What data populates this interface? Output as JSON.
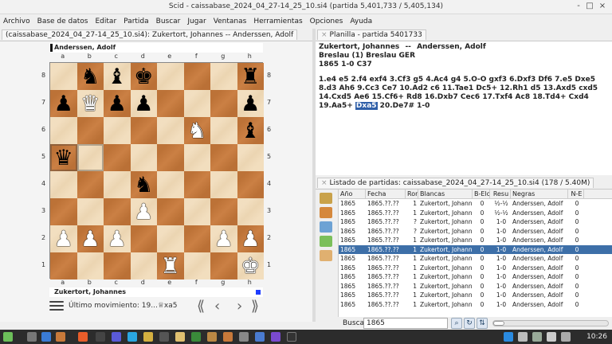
{
  "window": {
    "title": "Scid - caissabase_2024_04_27-14_25_10.si4 (partida 5,401,733 / 5,405,134)",
    "controls": [
      "-",
      "□",
      "×"
    ]
  },
  "menu": [
    "Archivo",
    "Base de datos",
    "Editar",
    "Partida",
    "Buscar",
    "Jugar",
    "Ventanas",
    "Herramientas",
    "Opciones",
    "Ayuda"
  ],
  "board_tab": "(caissabase_2024_04_27-14_25_10.si4): Zukertort, Johannes -- Anderssen, Adolf",
  "board": {
    "top_player": "Anderssen, Adolf",
    "bottom_player": "Zukertort, Johannes",
    "files": [
      "a",
      "b",
      "c",
      "d",
      "e",
      "f",
      "g",
      "h"
    ],
    "ranks": [
      "8",
      "7",
      "6",
      "5",
      "4",
      "3",
      "2",
      "1"
    ],
    "squares": [
      [
        "",
        "bN",
        "bB",
        "bK",
        "",
        "",
        "",
        "bR"
      ],
      [
        "bP",
        "wQ",
        "bP",
        "bP",
        "",
        "",
        "",
        "bP"
      ],
      [
        "",
        "",
        "",
        "",
        "",
        "wN",
        "",
        "bB"
      ],
      [
        "bQ",
        "",
        "",
        "",
        "",
        "",
        "",
        ""
      ],
      [
        "",
        "",
        "",
        "bN",
        "",
        "",
        "",
        ""
      ],
      [
        "",
        "",
        "",
        "wP",
        "",
        "",
        "",
        ""
      ],
      [
        "wP",
        "wP",
        "wP",
        "",
        "",
        "",
        "wP",
        "wP"
      ],
      [
        "",
        "",
        "",
        "",
        "wR",
        "",
        "",
        "wK"
      ]
    ],
    "highlight": [
      "a5",
      "b5"
    ],
    "last_move_label": "Último movimiento: 19...♕xa5",
    "nav_buttons": [
      "⟪",
      "‹",
      "›",
      "⟫"
    ]
  },
  "game_tab": "Planilla - partida 5401733",
  "game": {
    "white": "Zukertort, Johannes",
    "separator": "--",
    "black": "Anderssen, Adolf",
    "event": "Breslau (1)  Breslau GER",
    "year_result_eco": "1865  1-0  C37",
    "moves_before": "1.e4 e5 2.f4 exf4 3.Cf3 g5 4.Ac4 g4 5.O-O gxf3 6.Dxf3 Df6 7.e5 Dxe5 8.d3 Ah6 9.Cc3 Ce7 10.Ad2 c6 11.Tae1 Dc5+ 12.Rh1 d5 13.Axd5 cxd5 14.Cxd5 Ae6 15.Cf6+ Rd8 16.Dxb7 Cec6 17.Txf4 Ac8 18.Td4+ Cxd4 19.Aa5+ ",
    "current_move": "Dxa5",
    "moves_after": " 20.De7# 1-0"
  },
  "list_tab": "Listado de partidas: caissabase_2024_04_27-14_25_10.si4 (178 / 5.40M)",
  "list": {
    "columns": [
      "Año",
      "Fecha",
      "Ron",
      "Blancas",
      "B-Elo",
      "Resu",
      "Negras",
      "N-E"
    ],
    "rows": [
      [
        "1865",
        "1865.??.??",
        "1",
        "Zukertort, Johanne",
        "0",
        "½-½",
        "Anderssen, Adolf",
        "0"
      ],
      [
        "1865",
        "1865.??.??",
        "1",
        "Zukertort, Johanne",
        "0",
        "½-½",
        "Anderssen, Adolf",
        "0"
      ],
      [
        "1865",
        "1865.??.??",
        "?",
        "Zukertort, Johanne",
        "0",
        "1-0",
        "Anderssen, Adolf",
        "0"
      ],
      [
        "1865",
        "1865.??.??",
        "?",
        "Zukertort, Johanne",
        "0",
        "1-0",
        "Anderssen, Adolf",
        "0"
      ],
      [
        "1865",
        "1865.??.??",
        "1",
        "Zukertort, Johanne",
        "0",
        "1-0",
        "Anderssen, Adolf",
        "0"
      ],
      [
        "1865",
        "1865.??.??",
        "1",
        "Zukertort, Johanne",
        "0",
        "1-0",
        "Anderssen, Adolf",
        "0"
      ],
      [
        "1865",
        "1865.??.??",
        "1",
        "Zukertort, Johanne",
        "0",
        "1-0",
        "Anderssen, Adolf",
        "0"
      ],
      [
        "1865",
        "1865.??.??",
        "1",
        "Zukertort, Johanne",
        "0",
        "1-0",
        "Anderssen, Adolf",
        "0"
      ],
      [
        "1865",
        "1865.??.??",
        "1",
        "Zukertort, Johanne",
        "0",
        "1-0",
        "Anderssen, Adolf",
        "0"
      ],
      [
        "1865",
        "1865.??.??",
        "1",
        "Zukertort, Johanne",
        "0",
        "1-0",
        "Anderssen, Adolf",
        "0"
      ],
      [
        "1865",
        "1865.??.??",
        "1",
        "Zukertort, Johanne",
        "0",
        "1-0",
        "Anderssen, Adolf",
        "0"
      ],
      [
        "1865",
        "1865.??.??",
        "1",
        "Zukertort, Johanne",
        "0",
        "1-0",
        "Anderssen, Adolf",
        "0"
      ]
    ],
    "selected_row": 5
  },
  "search": {
    "label": "Buscar",
    "value": "1865"
  },
  "taskbar": {
    "clock": "10:26"
  },
  "colors": {
    "light_square": "#f0d9b5",
    "dark_square": "#c8793a",
    "selection": "#3d6fa8"
  }
}
